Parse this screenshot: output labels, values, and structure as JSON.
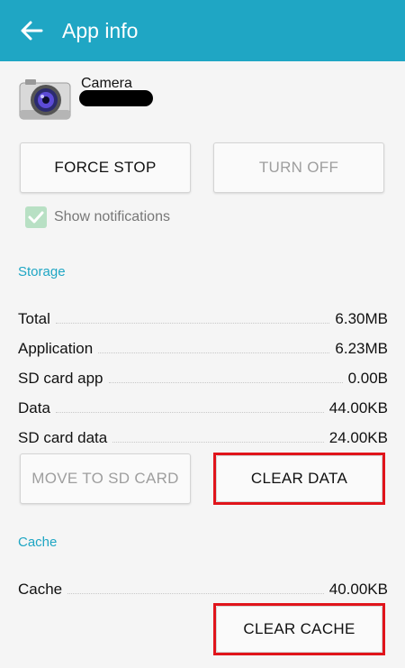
{
  "header": {
    "title": "App info"
  },
  "app": {
    "name": "Camera"
  },
  "actions": {
    "force_stop": "FORCE STOP",
    "turn_off": "TURN OFF"
  },
  "notifications": {
    "label": "Show notifications",
    "checked": true
  },
  "storage": {
    "header": "Storage",
    "rows": [
      {
        "label": "Total",
        "value": "6.30MB"
      },
      {
        "label": "Application",
        "value": "6.23MB"
      },
      {
        "label": "SD card app",
        "value": "0.00B"
      },
      {
        "label": "Data",
        "value": "44.00KB"
      },
      {
        "label": "SD card data",
        "value": "24.00KB"
      }
    ],
    "move_to_sd": "MOVE TO SD CARD",
    "clear_data": "CLEAR DATA"
  },
  "cache": {
    "header": "Cache",
    "rows": [
      {
        "label": "Cache",
        "value": "40.00KB"
      }
    ],
    "clear_cache": "CLEAR CACHE"
  },
  "colors": {
    "appbar": "#1fa6c4",
    "accent": "#1fa6c4",
    "highlight": "#e0141b"
  }
}
